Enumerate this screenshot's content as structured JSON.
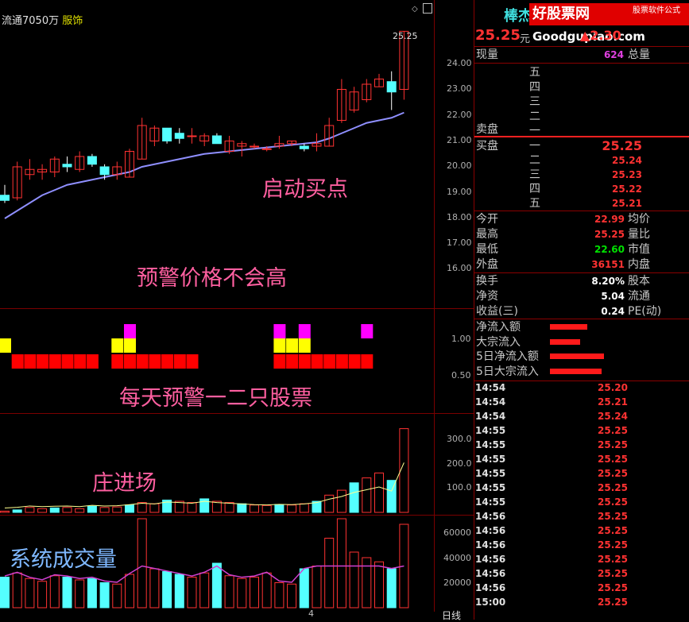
{
  "header": {
    "info_prefix": "流通7050万",
    "info_industry": "服饰",
    "stock_name": "棒杰",
    "icons": [
      "diamond-icon",
      "restore-icon"
    ]
  },
  "watermark": {
    "brand": "好股票网",
    "domain": "Goodgupiao.com",
    "tagline": "股票软件公式"
  },
  "overlays": {
    "buy_point": "启动买点",
    "warning_price": "预警价格不会高",
    "daily_warning": "每天预警一二只股票",
    "dealer_entry": "庄进场",
    "system_volume": "系统成交量"
  },
  "price_axis": [
    "24.00",
    "23.00",
    "22.00",
    "21.00",
    "20.00",
    "19.00",
    "18.00",
    "17.00",
    "16.00"
  ],
  "signal_axis": [
    "1.00",
    "0.50"
  ],
  "dealer_axis": [
    "300.0",
    "200.0",
    "100.0"
  ],
  "volume_axis": [
    "60000",
    "40000",
    "20000"
  ],
  "bottom": {
    "marker": "4",
    "period": "日线"
  },
  "last_price_marker": "25.25",
  "quote": {
    "price": "25.25",
    "unit": "元",
    "change": "▲2.30",
    "volume_label": "现量",
    "volume_value": "624",
    "total_label": "总量",
    "sell_label": "卖盘",
    "buy_label": "买盘",
    "ask_levels": [
      "五",
      "四",
      "三",
      "二",
      "一"
    ],
    "bid_levels": [
      {
        "level": "一",
        "price": "25.25"
      },
      {
        "level": "二",
        "price": "25.24"
      },
      {
        "level": "三",
        "price": "25.23"
      },
      {
        "level": "四",
        "price": "25.22"
      },
      {
        "level": "五",
        "price": "25.21"
      }
    ],
    "stats": [
      {
        "label": "今开",
        "value": "22.99",
        "label2": "均价",
        "color": "red"
      },
      {
        "label": "最高",
        "value": "25.25",
        "label2": "量比",
        "color": "red"
      },
      {
        "label": "最低",
        "value": "22.60",
        "label2": "市值",
        "color": "green"
      },
      {
        "label": "外盘",
        "value": "36151",
        "label2": "内盘",
        "color": "red"
      }
    ],
    "fundamentals": [
      {
        "label": "换手",
        "value": "8.20%",
        "label2": "股本"
      },
      {
        "label": "净资",
        "value": "5.04",
        "label2": "流通"
      },
      {
        "label": "收益(三)",
        "value": "0.24",
        "label2": "PE(动)"
      }
    ],
    "flows": [
      {
        "label": "净流入额",
        "level": 0.55
      },
      {
        "label": "大宗流入",
        "level": 0.45
      },
      {
        "label": "5日净流入额",
        "level": 0.8
      },
      {
        "label": "5日大宗流入",
        "level": 0.77
      }
    ]
  },
  "ticks": [
    {
      "time": "14:54",
      "price": "25.20"
    },
    {
      "time": "14:54",
      "price": "25.21"
    },
    {
      "time": "14:54",
      "price": "25.24"
    },
    {
      "time": "14:55",
      "price": "25.25"
    },
    {
      "time": "14:55",
      "price": "25.25"
    },
    {
      "time": "14:55",
      "price": "25.25"
    },
    {
      "time": "14:55",
      "price": "25.25"
    },
    {
      "time": "14:55",
      "price": "25.25"
    },
    {
      "time": "14:55",
      "price": "25.25"
    },
    {
      "time": "14:56",
      "price": "25.25"
    },
    {
      "time": "14:56",
      "price": "25.25"
    },
    {
      "time": "14:56",
      "price": "25.25"
    },
    {
      "time": "14:56",
      "price": "25.25"
    },
    {
      "time": "14:56",
      "price": "25.25"
    },
    {
      "time": "14:56",
      "price": "25.25"
    },
    {
      "time": "15:00",
      "price": "25.25"
    }
  ],
  "chart_data": {
    "type": "candlestick",
    "candles": [
      {
        "o": 18.9,
        "h": 19.3,
        "l": 18.6,
        "c": 18.7
      },
      {
        "o": 18.8,
        "h": 20.2,
        "l": 18.7,
        "c": 20.0
      },
      {
        "o": 19.7,
        "h": 20.3,
        "l": 19.5,
        "c": 19.9
      },
      {
        "o": 19.8,
        "h": 20.1,
        "l": 19.5,
        "c": 19.9
      },
      {
        "o": 19.8,
        "h": 20.4,
        "l": 19.6,
        "c": 20.3
      },
      {
        "o": 20.1,
        "h": 20.4,
        "l": 19.8,
        "c": 20.0
      },
      {
        "o": 19.9,
        "h": 20.6,
        "l": 19.8,
        "c": 20.4
      },
      {
        "o": 20.4,
        "h": 20.5,
        "l": 20.0,
        "c": 20.1
      },
      {
        "o": 20.0,
        "h": 20.1,
        "l": 19.5,
        "c": 19.7
      },
      {
        "o": 19.7,
        "h": 20.2,
        "l": 19.5,
        "c": 20.0
      },
      {
        "o": 19.6,
        "h": 20.7,
        "l": 19.6,
        "c": 20.6
      },
      {
        "o": 20.3,
        "h": 21.9,
        "l": 20.3,
        "c": 21.6
      },
      {
        "o": 21.0,
        "h": 21.6,
        "l": 20.8,
        "c": 21.5
      },
      {
        "o": 21.5,
        "h": 21.5,
        "l": 20.9,
        "c": 21.0
      },
      {
        "o": 21.3,
        "h": 21.5,
        "l": 20.9,
        "c": 21.1
      },
      {
        "o": 21.2,
        "h": 21.5,
        "l": 20.9,
        "c": 21.2
      },
      {
        "o": 21.0,
        "h": 21.3,
        "l": 20.8,
        "c": 21.2
      },
      {
        "o": 21.2,
        "h": 21.3,
        "l": 20.9,
        "c": 20.9
      },
      {
        "o": 20.6,
        "h": 21.2,
        "l": 20.5,
        "c": 21.0
      },
      {
        "o": 20.8,
        "h": 21.0,
        "l": 20.4,
        "c": 20.9
      },
      {
        "o": 20.8,
        "h": 20.9,
        "l": 20.7,
        "c": 20.8
      },
      {
        "o": 20.7,
        "h": 20.8,
        "l": 20.6,
        "c": 20.7
      },
      {
        "o": 20.8,
        "h": 21.2,
        "l": 20.7,
        "c": 20.9
      },
      {
        "o": 20.9,
        "h": 21.0,
        "l": 20.8,
        "c": 21.0
      },
      {
        "o": 20.8,
        "h": 20.9,
        "l": 20.6,
        "c": 20.7
      },
      {
        "o": 20.8,
        "h": 21.3,
        "l": 20.6,
        "c": 20.9
      },
      {
        "o": 20.8,
        "h": 21.9,
        "l": 20.8,
        "c": 21.6
      },
      {
        "o": 21.8,
        "h": 23.4,
        "l": 21.7,
        "c": 23.0
      },
      {
        "o": 22.2,
        "h": 23.1,
        "l": 22.1,
        "c": 22.9
      },
      {
        "o": 22.6,
        "h": 23.4,
        "l": 22.5,
        "c": 23.2
      },
      {
        "o": 23.1,
        "h": 23.6,
        "l": 23.1,
        "c": 23.4
      },
      {
        "o": 23.3,
        "h": 23.7,
        "l": 22.2,
        "c": 22.9
      },
      {
        "o": 23.0,
        "h": 25.25,
        "l": 22.6,
        "c": 25.25
      }
    ],
    "ma": [
      18.0,
      18.3,
      18.6,
      18.9,
      19.1,
      19.3,
      19.4,
      19.5,
      19.6,
      19.7,
      19.8,
      20.0,
      20.1,
      20.2,
      20.3,
      20.4,
      20.5,
      20.55,
      20.6,
      20.65,
      20.7,
      20.75,
      20.8,
      20.85,
      20.9,
      20.95,
      21.1,
      21.3,
      21.5,
      21.7,
      21.8,
      21.9,
      22.1
    ],
    "volume": [
      22000,
      25000,
      21000,
      19000,
      23000,
      22000,
      20000,
      21000,
      18000,
      17000,
      24000,
      64000,
      28000,
      26000,
      24000,
      22000,
      25000,
      32000,
      23000,
      21000,
      22000,
      25000,
      18000,
      17000,
      28000,
      30000,
      50000,
      64000,
      40000,
      36000,
      33000,
      28000,
      60000
    ],
    "dealer": [
      5,
      10,
      20,
      15,
      18,
      20,
      15,
      25,
      20,
      22,
      30,
      40,
      35,
      50,
      45,
      40,
      55,
      45,
      40,
      35,
      30,
      28,
      32,
      30,
      35,
      45,
      70,
      90,
      120,
      140,
      160,
      130,
      340
    ],
    "signals": [
      [
        0,
        1,
        0
      ],
      [
        1,
        0,
        0
      ],
      [
        1,
        0,
        0
      ],
      [
        1,
        0,
        0
      ],
      [
        1,
        0,
        0
      ],
      [
        1,
        0,
        0
      ],
      [
        1,
        0,
        0
      ],
      [
        1,
        0,
        0
      ],
      [
        0,
        0,
        0
      ],
      [
        1,
        1,
        0
      ],
      [
        1,
        1,
        1
      ],
      [
        1,
        0,
        0
      ],
      [
        1,
        0,
        0
      ],
      [
        1,
        0,
        0
      ],
      [
        1,
        0,
        0
      ],
      [
        1,
        0,
        0
      ],
      [
        0,
        0,
        0
      ],
      [
        0,
        0,
        0
      ],
      [
        0,
        0,
        0
      ],
      [
        0,
        0,
        0
      ],
      [
        0,
        0,
        0
      ],
      [
        0,
        0,
        0
      ],
      [
        1,
        1,
        1
      ],
      [
        1,
        1,
        0
      ],
      [
        1,
        1,
        1
      ],
      [
        1,
        0,
        0
      ],
      [
        1,
        0,
        0
      ],
      [
        1,
        0,
        0
      ],
      [
        1,
        0,
        0
      ],
      [
        1,
        0,
        1
      ],
      [
        0,
        0,
        0
      ],
      [
        0,
        0,
        0
      ],
      [
        0,
        0,
        0
      ]
    ],
    "colors": {
      "up": "#ff3232",
      "down": "#54ffff",
      "ma": "#8f8fff",
      "dealer_line": "#ffff8f",
      "volume_ma": "#d040d0"
    }
  }
}
